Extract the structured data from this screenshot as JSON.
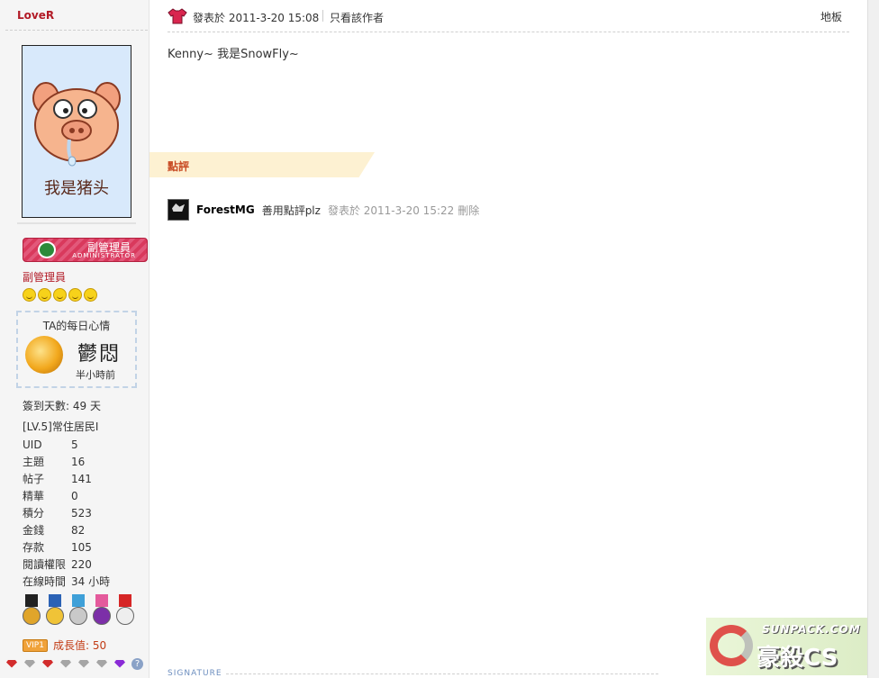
{
  "author": {
    "username": "LoveR",
    "avatar_caption": "我是猪头",
    "badge": {
      "title": "副管理員",
      "subtitle": "ADMINISTRATOR"
    },
    "group": "副管理員",
    "star_icon_count": 5,
    "mood": {
      "title": "TA的每日心情",
      "word": "鬱悶",
      "time": "半小時前",
      "icon": "mood-orb-icon"
    },
    "checkin": "簽到天數: 49 天",
    "level": "[LV.5]常住居民I",
    "stats": [
      {
        "key": "UID",
        "value": "5"
      },
      {
        "key": "主題",
        "value": "16"
      },
      {
        "key": "帖子",
        "value": "141"
      },
      {
        "key": "精華",
        "value": "0"
      },
      {
        "key": "積分",
        "value": "523"
      },
      {
        "key": "金錢",
        "value": "82"
      },
      {
        "key": "存款",
        "value": "105"
      },
      {
        "key": "閱讀權限",
        "value": "220"
      },
      {
        "key": "在線時間",
        "value": "34 小時"
      }
    ],
    "vip": {
      "badge": "VIP1",
      "growth": "成長值: 50"
    }
  },
  "post": {
    "posted_time": "發表於 2011-3-20 15:08",
    "only_author_link": "只看該作者",
    "floor": "地板",
    "content": "Kenny~ 我是SnowFly~"
  },
  "rating": {
    "tab_label": "點評",
    "entries": [
      {
        "user": "ForestMG",
        "comment": "善用點評plz",
        "time": "發表於 2011-3-20 15:22",
        "delete_label": "刪除"
      }
    ]
  },
  "signature_label": "SIGNATURE",
  "watermark": {
    "url": "SUNPACK.COM",
    "name": "豪殺CS"
  },
  "colors": {
    "username": "#b21a26",
    "rate_tab_bg": "#fdf1d2",
    "rate_tab_text": "#c84a23",
    "signature": "#6c8ebf"
  }
}
